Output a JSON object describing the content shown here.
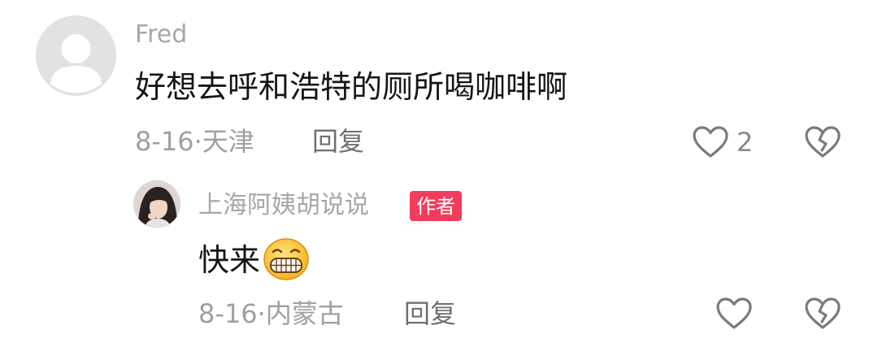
{
  "comment": {
    "username": "Fred",
    "text": "好想去呼和浩特的厕所喝咖啡啊",
    "date": "8-16",
    "separator": "·",
    "location": "天津",
    "reply_label": "回复",
    "like_count": "2",
    "avatar_icon": "default-avatar-icon",
    "like_icon": "heart-outline-icon",
    "dislike_icon": "broken-heart-icon"
  },
  "reply": {
    "username": "上海阿姨胡说说",
    "badge": "作者",
    "text": "快来",
    "emoji_icon": "grinning-face-icon",
    "date": "8-16",
    "separator": "·",
    "location": "内蒙古",
    "reply_label": "回复",
    "avatar_icon": "author-avatar-photo",
    "like_icon": "heart-outline-icon",
    "dislike_icon": "broken-heart-icon"
  },
  "colors": {
    "badge_background": "#f23d5c",
    "username": "#a7a7a7",
    "comment_text": "#161616",
    "meta_text": "#a0a0a0",
    "icon_stroke": "#7b7b7b"
  }
}
